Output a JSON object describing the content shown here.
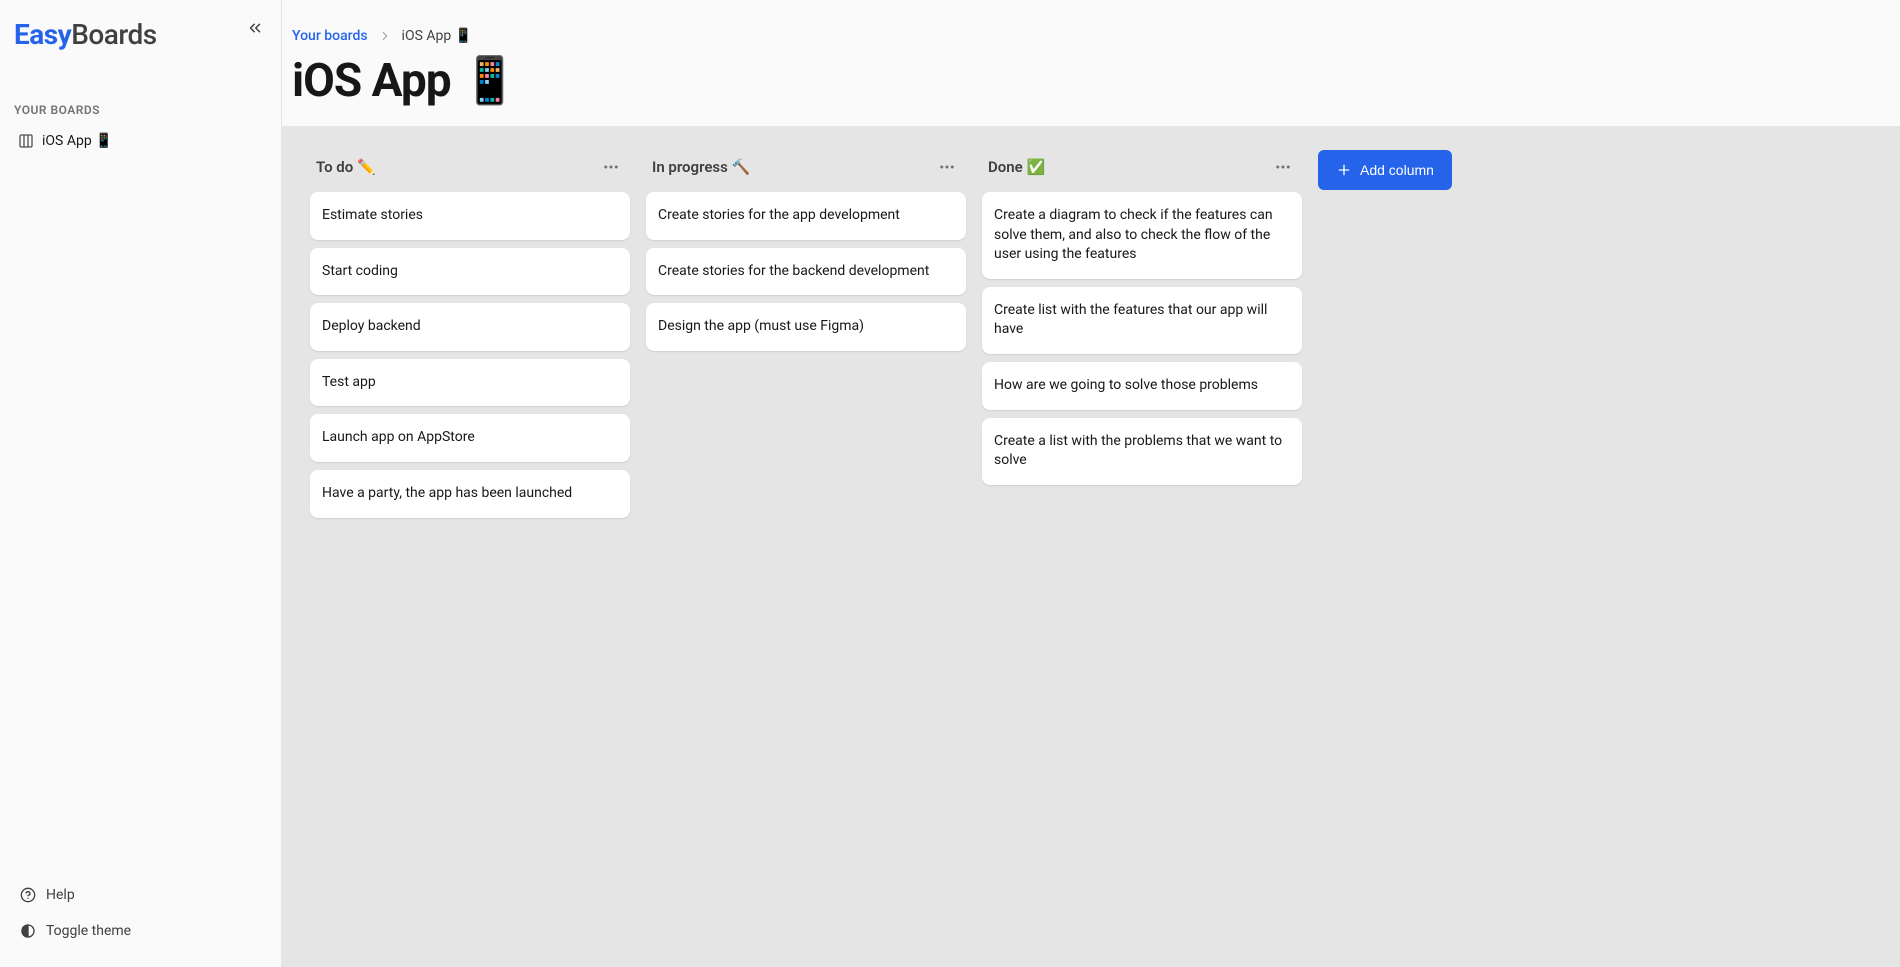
{
  "logo": {
    "part1": "Easy",
    "part2": "Boards"
  },
  "sidebar": {
    "section_label": "YOUR BOARDS",
    "items": [
      {
        "label": "iOS App 📱"
      }
    ],
    "footer": {
      "help": "Help",
      "theme": "Toggle theme"
    }
  },
  "breadcrumb": {
    "root": "Your boards",
    "current": "iOS App 📱"
  },
  "page_title": "iOS App 📱",
  "add_column_label": "Add column",
  "columns": [
    {
      "title": "To do ✏️",
      "cards": [
        "Estimate stories",
        "Start coding",
        "Deploy backend",
        "Test app",
        "Launch app on AppStore",
        "Have a party, the app has been launched"
      ]
    },
    {
      "title": "In progress 🔨",
      "cards": [
        "Create stories for the app development",
        "Create stories for the backend development",
        "Design the app (must use Figma)"
      ]
    },
    {
      "title": "Done ✅",
      "cards": [
        "Create a diagram to check if the features can solve them, and also to check the flow of the user using the features",
        "Create list with the features that our app will have",
        "How are we going to solve those problems",
        "Create a list with the problems that we want to solve"
      ]
    }
  ]
}
